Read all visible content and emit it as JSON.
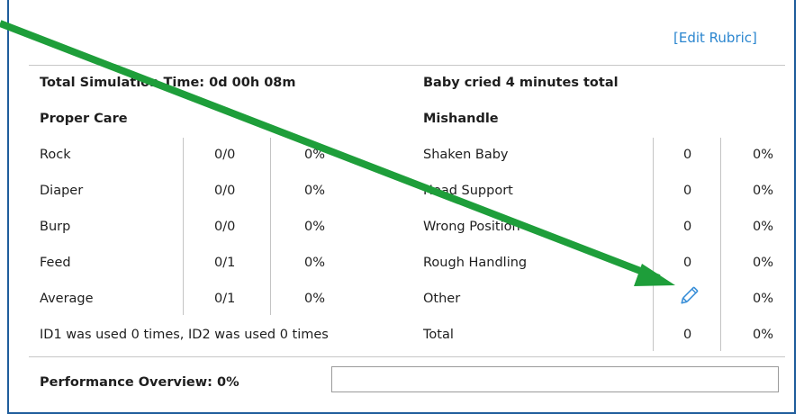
{
  "header": {
    "edit_link": "[Edit Rubric]"
  },
  "summary": {
    "total_time": "Total Simulation Time: 0d 00h 08m",
    "baby_cried": "Baby cried 4 minutes total"
  },
  "proper_care": {
    "heading": "Proper Care",
    "rows": [
      {
        "label": "Rock",
        "count": "0/0",
        "pct": "0%"
      },
      {
        "label": "Diaper",
        "count": "0/0",
        "pct": "0%"
      },
      {
        "label": "Burp",
        "count": "0/0",
        "pct": "0%"
      },
      {
        "label": "Feed",
        "count": "0/1",
        "pct": "0%"
      },
      {
        "label": "Average",
        "count": "0/1",
        "pct": "0%"
      }
    ],
    "id_note": "ID1 was used 0 times, ID2 was used 0 times"
  },
  "mishandle": {
    "heading": "Mishandle",
    "rows": [
      {
        "label": "Shaken Baby",
        "count": "0",
        "pct": "0%"
      },
      {
        "label": "Head Support",
        "count": "0",
        "pct": "0%"
      },
      {
        "label": "Wrong Position",
        "count": "0",
        "pct": "0%"
      },
      {
        "label": "Rough Handling",
        "count": "0",
        "pct": "0%"
      },
      {
        "label": "Other",
        "count": "",
        "pct": "0%",
        "icon": "pencil-icon"
      },
      {
        "label": "Total",
        "count": "0",
        "pct": "0%"
      }
    ]
  },
  "performance": {
    "label": "Performance Overview: 0%",
    "value_fraction": 0
  },
  "colors": {
    "link": "#2b86cf",
    "border": "#1f5d9c",
    "annotation_arrow": "#1e9e3a"
  }
}
